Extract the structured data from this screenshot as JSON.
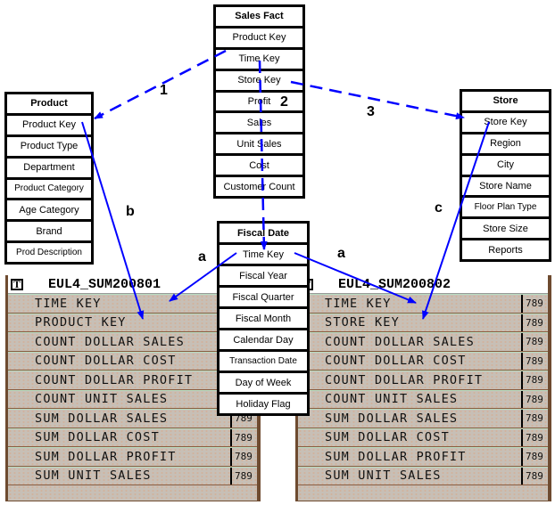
{
  "boxes": {
    "sales_fact": {
      "title": "Sales Fact",
      "items": [
        "Product Key",
        "Time Key",
        "Store Key",
        "Profit",
        "Sales",
        "Unit Sales",
        "Cost",
        "Customer Count"
      ]
    },
    "product": {
      "title": "Product",
      "items": [
        "Product Key",
        "Product Type",
        "Department",
        "Product Category",
        "Age Category",
        "Brand",
        "Prod Description"
      ]
    },
    "store": {
      "title": "Store",
      "items": [
        "Store Key",
        "Region",
        "City",
        "Store Name",
        "Floor Plan Type",
        "Store Size",
        "Reports"
      ]
    },
    "fiscal_date": {
      "title": "Fiscal Date",
      "items": [
        "Time Key",
        "Fiscal Year",
        "Fiscal Quarter",
        "Fiscal Month",
        "Calendar Day",
        "Transaction Date",
        "Day of Week",
        "Holiday Flag"
      ]
    }
  },
  "tables": {
    "left": {
      "icon": "T",
      "title": "EUL4_SUM200801",
      "type_icon": "789",
      "rows": [
        "TIME KEY",
        "PRODUCT KEY",
        "COUNT DOLLAR SALES",
        "COUNT DOLLAR COST",
        "COUNT DOLLAR PROFIT",
        "COUNT UNIT SALES",
        "SUM DOLLAR SALES",
        "SUM DOLLAR COST",
        "SUM DOLLAR PROFIT",
        "SUM UNIT SALES"
      ]
    },
    "right": {
      "icon": "T",
      "title": "EUL4_SUM200802",
      "type_icon": "789",
      "rows": [
        "TIME KEY",
        "STORE KEY",
        "COUNT DOLLAR SALES",
        "COUNT DOLLAR COST",
        "COUNT DOLLAR PROFIT",
        "COUNT UNIT SALES",
        "SUM DOLLAR SALES",
        "SUM DOLLAR COST",
        "SUM DOLLAR PROFIT",
        "SUM UNIT SALES"
      ]
    }
  },
  "labels": {
    "one": "1",
    "two": "2",
    "three": "3",
    "a_left": "a",
    "a_right": "a",
    "b": "b",
    "c": "c"
  },
  "colors": {
    "arrow": "#0000ff"
  }
}
